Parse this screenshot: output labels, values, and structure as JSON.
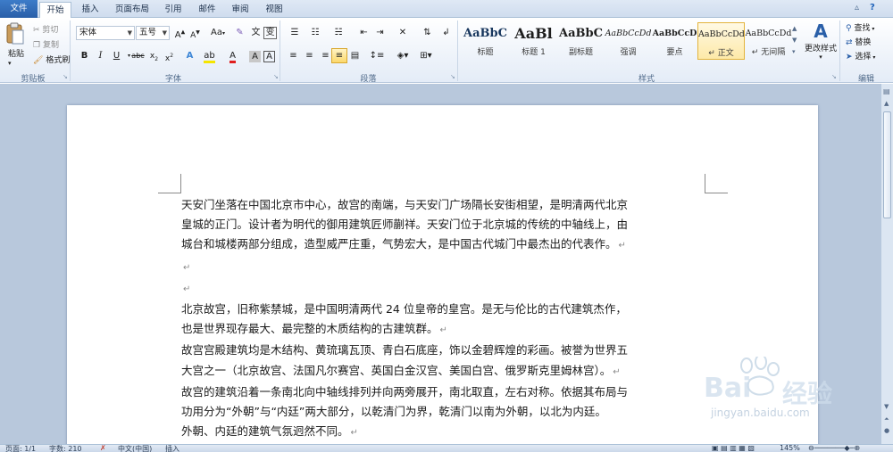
{
  "tabs": {
    "file": "文件",
    "home": "开始",
    "insert": "插入",
    "layout": "页面布局",
    "references": "引用",
    "mailings": "邮件",
    "review": "审阅",
    "view": "视图"
  },
  "clipboard": {
    "paste": "粘贴",
    "cut": "剪切",
    "copy": "复制",
    "format_painter": "格式刷",
    "label": "剪贴板"
  },
  "font": {
    "family": "宋体",
    "size": "五号",
    "change_case": "Aa",
    "wen": "文",
    "bian": "变",
    "a_char": "A",
    "label": "字体"
  },
  "paragraph": {
    "label": "段落"
  },
  "styles": {
    "items": [
      {
        "sample": "AaBbC",
        "name": "标题"
      },
      {
        "sample": "AaBl",
        "name": "标题 1"
      },
      {
        "sample": "AaBbC",
        "name": "副标题"
      },
      {
        "sample": "AaBbCcDd",
        "name": "强调"
      },
      {
        "sample": "AaBbCcD",
        "name": "要点"
      },
      {
        "sample": "AaBbCcDd",
        "name": "↵ 正文"
      },
      {
        "sample": "AaBbCcDd",
        "name": "↵ 无间隔"
      }
    ],
    "change_styles": "更改样式",
    "label": "样式"
  },
  "editing": {
    "find": "查找",
    "replace": "替换",
    "select": "选择",
    "label": "编辑"
  },
  "document": {
    "lines": [
      "天安门坐落在中国北京市中心，故宫的南端，与天安门广场隔长安街相望，是明清两代北京",
      "皇城的正门。设计者为明代的御用建筑匠师蒯祥。天安门位于北京城的传统的中轴线上，由",
      "城台和城楼两部分组成，造型威严庄重，气势宏大，是中国古代城门中最杰出的代表作。",
      "",
      "",
      "北京故宫，旧称紫禁城，是中国明清两代 24 位皇帝的皇宫。是无与伦比的古代建筑杰作，",
      "也是世界现存最大、最完整的木质结构的古建筑群。",
      "故宫宫殿建筑均是木结构、黄琉璃瓦顶、青白石底座，饰以金碧辉煌的彩画。被誉为世界五",
      "大宫之一（北京故宫、法国凡尔赛宫、英国白金汉宫、美国白宫、俄罗斯克里姆林宫）。",
      "故宫的建筑沿着一条南北向中轴线排列并向两旁展开，南北取直，左右对称。依据其布局与",
      "功用分为“外朝”与“内廷”两大部分，以乾清门为界，乾清门以南为外朝，以北为内廷。",
      "外朝、内廷的建筑气氛迥然不同。"
    ],
    "para_mark": "↵"
  },
  "watermark": {
    "brand": "Bai",
    "brand2": "经验",
    "url": "jingyan.baidu.com"
  },
  "status": {
    "page": "页面: 1/1",
    "words": "字数: 210",
    "lang": "中文(中国)",
    "insert": "插入",
    "zoom": "145%"
  },
  "colors": {
    "accent": "#2a5fa8",
    "ribbon": "#eef3fa",
    "doc_bg": "#b8c8dc",
    "highlight": "#fde9a8"
  }
}
